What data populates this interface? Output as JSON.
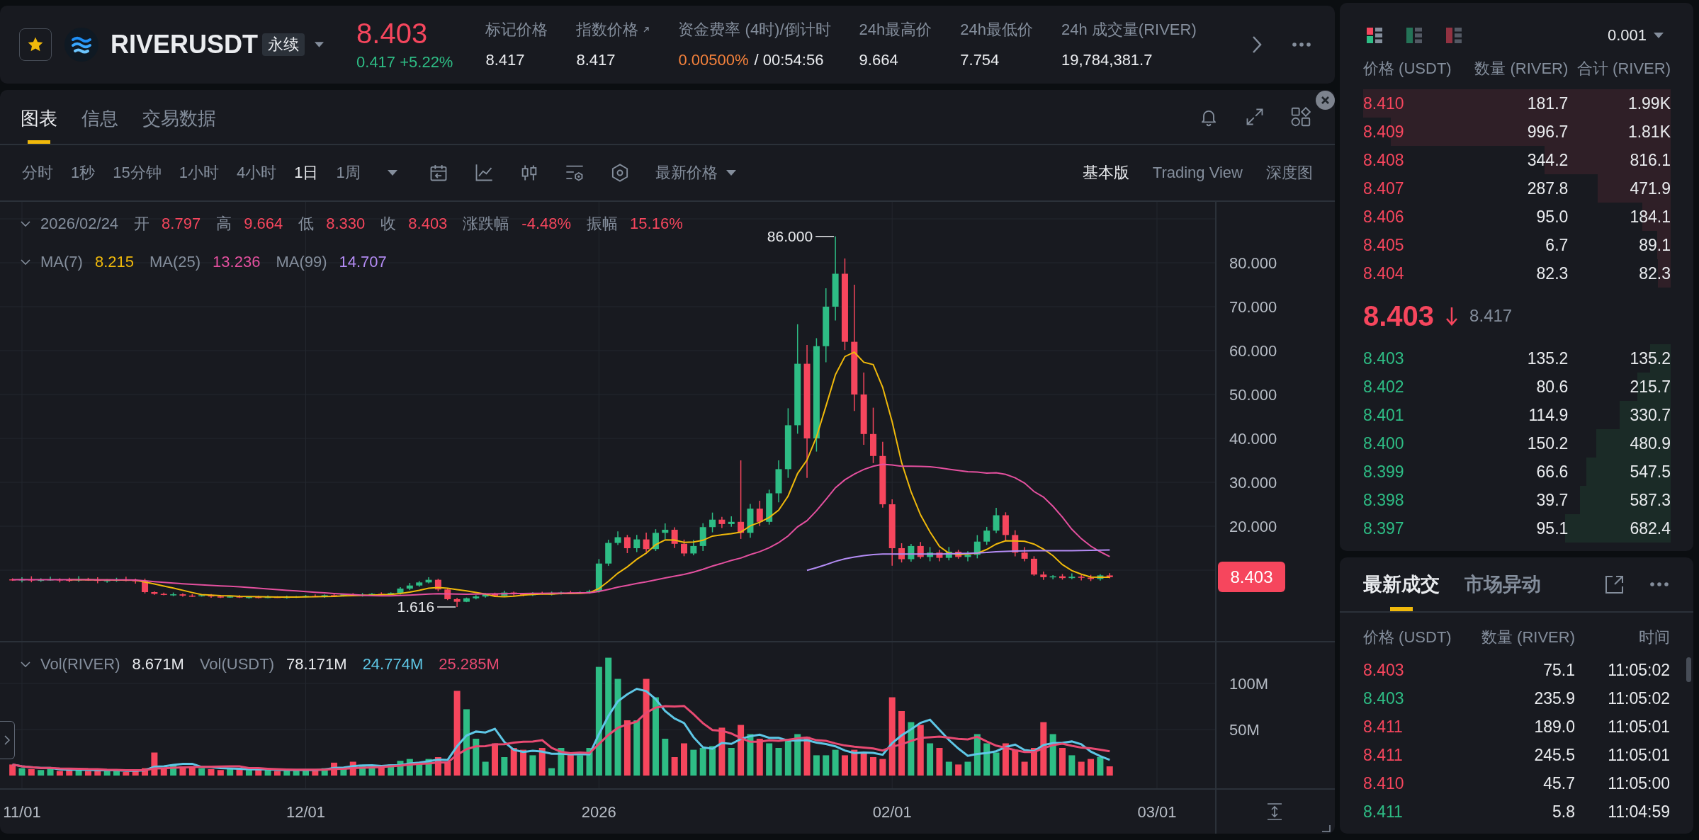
{
  "header": {
    "symbol": "RIVERUSDT",
    "contract": "永续",
    "last_price": {
      "text": "8.403",
      "up": false
    },
    "change": {
      "text": "0.417 +5.22%",
      "up": true
    },
    "stats": [
      {
        "kind": "plain",
        "label": "标记价格",
        "value": "8.417"
      },
      {
        "kind": "link",
        "label": "指数价格",
        "value": "8.417"
      },
      {
        "kind": "funding",
        "label": "资金费率 (4时)/倒计时",
        "value": "0.00500%",
        "countdown": "/ 00:54:56"
      },
      {
        "kind": "plain",
        "label": "24h最高价",
        "value": "9.664"
      },
      {
        "kind": "plain",
        "label": "24h最低价",
        "value": "7.754"
      },
      {
        "kind": "plain",
        "label": "24h 成交量(RIVER)",
        "value": "19,784,381.7"
      }
    ]
  },
  "chart_panel": {
    "tabs": [
      {
        "label": "图表",
        "selected": true
      },
      {
        "label": "信息",
        "selected": false
      },
      {
        "label": "交易数据",
        "selected": false
      }
    ],
    "intervals": [
      {
        "label": "分时",
        "selected": false
      },
      {
        "label": "1秒",
        "selected": false
      },
      {
        "label": "15分钟",
        "selected": false
      },
      {
        "label": "1小时",
        "selected": false
      },
      {
        "label": "4小时",
        "selected": false
      },
      {
        "label": "1日",
        "selected": true
      },
      {
        "label": "1周",
        "selected": false
      }
    ],
    "price_source": "最新价格",
    "views": [
      {
        "label": "基本版",
        "selected": true
      },
      {
        "label": "Trading View",
        "selected": false
      },
      {
        "label": "深度图",
        "selected": false
      }
    ],
    "ohlc_legend": {
      "date": "2026/02/24",
      "up": false,
      "items": [
        {
          "label": "开",
          "value": "8.797"
        },
        {
          "label": "高",
          "value": "9.664"
        },
        {
          "label": "低",
          "value": "8.330"
        },
        {
          "label": "收",
          "value": "8.403"
        },
        {
          "label": "涨跌幅",
          "value": "-4.48%"
        },
        {
          "label": "振幅",
          "value": "15.16%"
        }
      ]
    },
    "ma_legend": [
      {
        "label": "MA(7)",
        "value": "8.215",
        "color": "#f0b90b"
      },
      {
        "label": "MA(25)",
        "value": "13.236",
        "color": "#e4509f"
      },
      {
        "label": "MA(99)",
        "value": "14.707",
        "color": "#b48cf5"
      }
    ],
    "price_axis": [
      "80.000",
      "70.000",
      "60.000",
      "50.000",
      "40.000",
      "30.000",
      "20.000"
    ],
    "high_marker": "86.000",
    "low_marker": "1.616",
    "price_tag": "8.403",
    "volume_legend": [
      {
        "label": "Vol(RIVER)",
        "value": "8.671M",
        "color": "#eaecef"
      },
      {
        "label": "Vol(USDT)",
        "value": "78.171M",
        "color": "#eaecef"
      },
      {
        "value": "24.774M",
        "color": "#5ec7e6"
      },
      {
        "value": "25.285M",
        "color": "#e84a72"
      }
    ],
    "volume_axis": [
      "100M",
      "50M"
    ],
    "time_axis": [
      "11/01",
      "12/01",
      "2026",
      "02/01",
      "03/01"
    ]
  },
  "order_book": {
    "layouts": [
      {
        "kind": "both",
        "selected": true
      },
      {
        "kind": "bids",
        "selected": false
      },
      {
        "kind": "asks",
        "selected": false
      }
    ],
    "precision": "0.001",
    "columns": [
      "价格 (USDT)",
      "数量 (RIVER)",
      "合计 (RIVER)"
    ],
    "asks": [
      {
        "price": "8.410",
        "amount": "181.7",
        "total": "1.99K"
      },
      {
        "price": "8.409",
        "amount": "996.7",
        "total": "1.81K"
      },
      {
        "price": "8.408",
        "amount": "344.2",
        "total": "816.1"
      },
      {
        "price": "8.407",
        "amount": "287.8",
        "total": "471.9"
      },
      {
        "price": "8.406",
        "amount": "95.0",
        "total": "184.1"
      },
      {
        "price": "8.405",
        "amount": "6.7",
        "total": "89.1"
      },
      {
        "price": "8.404",
        "amount": "82.3",
        "total": "82.3"
      }
    ],
    "last": {
      "price": "8.403",
      "up": false,
      "mark": "8.417"
    },
    "bids": [
      {
        "price": "8.403",
        "amount": "135.2",
        "total": "135.2"
      },
      {
        "price": "8.402",
        "amount": "80.6",
        "total": "215.7"
      },
      {
        "price": "8.401",
        "amount": "114.9",
        "total": "330.7"
      },
      {
        "price": "8.400",
        "amount": "150.2",
        "total": "480.9"
      },
      {
        "price": "8.399",
        "amount": "66.6",
        "total": "547.5"
      },
      {
        "price": "8.398",
        "amount": "39.7",
        "total": "587.3"
      },
      {
        "price": "8.397",
        "amount": "95.1",
        "total": "682.4"
      }
    ]
  },
  "trades": {
    "tabs": [
      {
        "label": "最新成交",
        "selected": true
      },
      {
        "label": "市场异动",
        "selected": false
      }
    ],
    "columns": [
      "价格 (USDT)",
      "数量 (RIVER)",
      "时间"
    ],
    "rows": [
      {
        "price": "8.403",
        "amount": "75.1",
        "time": "11:05:02",
        "color": "#f6465d"
      },
      {
        "price": "8.403",
        "amount": "235.9",
        "time": "11:05:02",
        "color": "#2ebd85"
      },
      {
        "price": "8.411",
        "amount": "189.0",
        "time": "11:05:01",
        "color": "#f6465d"
      },
      {
        "price": "8.411",
        "amount": "245.5",
        "time": "11:05:01",
        "color": "#f6465d"
      },
      {
        "price": "8.410",
        "amount": "45.7",
        "time": "11:05:00",
        "color": "#f6465d"
      },
      {
        "price": "8.411",
        "amount": "5.8",
        "time": "11:04:59",
        "color": "#2ebd85"
      }
    ]
  }
}
